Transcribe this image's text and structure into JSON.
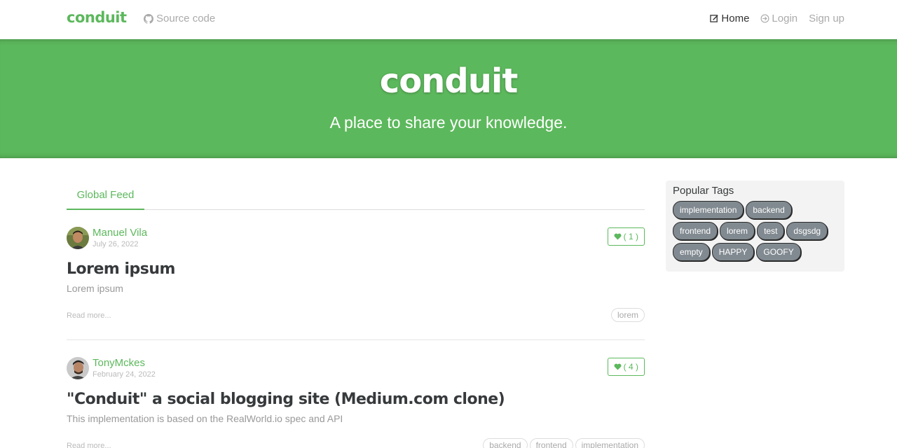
{
  "nav": {
    "brand": "conduit",
    "source_code": "Source code",
    "links": [
      {
        "label": "Home",
        "active": true,
        "icon": "compose-icon"
      },
      {
        "label": "Login",
        "active": false,
        "icon": "sign-in-icon"
      },
      {
        "label": "Sign up",
        "active": false
      }
    ]
  },
  "banner": {
    "title": "conduit",
    "subtitle": "A place to share your knowledge."
  },
  "feed": {
    "tab": "Global Feed",
    "articles": [
      {
        "author": "Manuel Vila",
        "date": "July 26, 2022",
        "favorites": "( 1 )",
        "title": "Lorem ipsum",
        "description": "Lorem ipsum",
        "read_more": "Read more...",
        "tags": [
          "lorem"
        ]
      },
      {
        "author": "TonyMckes",
        "date": "February 24, 2022",
        "favorites": "( 4 )",
        "title": "\"Conduit\" a social blogging site (Medium.com clone)",
        "description": "This implementation is based on the RealWorld.io spec and API",
        "read_more": "Read more...",
        "tags": [
          "backend",
          "frontend",
          "implementation"
        ]
      }
    ]
  },
  "sidebar": {
    "title": "Popular Tags",
    "tags": [
      "implementation",
      "backend",
      "frontend",
      "lorem",
      "test",
      "dsgsdg",
      "empty",
      "HAPPY",
      "GOOFY"
    ]
  },
  "colors": {
    "accent": "#5cb85c",
    "tag_bg": "#818a91"
  }
}
